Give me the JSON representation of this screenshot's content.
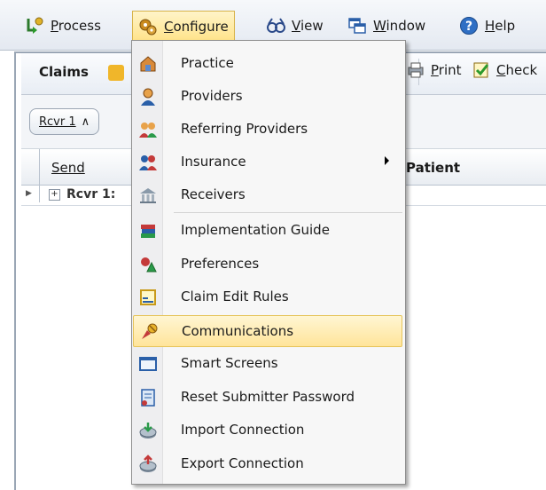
{
  "menubar": {
    "items": [
      {
        "label": "Process",
        "icon": "process-icon"
      },
      {
        "label": "Configure",
        "icon": "configure-icon"
      },
      {
        "label": "View",
        "icon": "view-icon"
      },
      {
        "label": "Window",
        "icon": "window-icon"
      },
      {
        "label": "Help",
        "icon": "help-icon"
      }
    ]
  },
  "toolbar": {
    "tab_label": "Claims",
    "print_label": "Print",
    "check_label": "Check"
  },
  "grouping": {
    "chip_label": "Rcvr 1",
    "chip_sort_glyph": "∧"
  },
  "grid": {
    "columns": [
      "Send",
      "Patient"
    ],
    "rows": [
      {
        "expand_glyph": "+",
        "text": "Rcvr 1:"
      }
    ]
  },
  "configure_menu": {
    "items": [
      {
        "label": "Practice",
        "icon": "practice-icon"
      },
      {
        "label": "Providers",
        "icon": "providers-icon"
      },
      {
        "label": "Referring Providers",
        "icon": "referring-providers-icon"
      },
      {
        "label": "Insurance",
        "icon": "insurance-icon",
        "submenu": true
      },
      {
        "label": "Receivers",
        "icon": "receivers-icon"
      },
      {
        "label": "Implementation Guide",
        "icon": "implementation-guide-icon"
      },
      {
        "label": "Preferences",
        "icon": "preferences-icon"
      },
      {
        "label": "Claim Edit Rules",
        "icon": "claim-edit-rules-icon"
      },
      {
        "label": "Communications",
        "icon": "communications-icon",
        "highlighted": true
      },
      {
        "label": "Smart Screens",
        "icon": "smart-screens-icon"
      },
      {
        "label": "Reset Submitter Password",
        "icon": "reset-password-icon"
      },
      {
        "label": "Import Connection",
        "icon": "import-connection-icon"
      },
      {
        "label": "Export Connection",
        "icon": "export-connection-icon"
      }
    ]
  },
  "colors": {
    "highlight": "#ffe49a",
    "menu_border": "#8f8f8f",
    "toolbar_bg": "#e8edf4"
  }
}
